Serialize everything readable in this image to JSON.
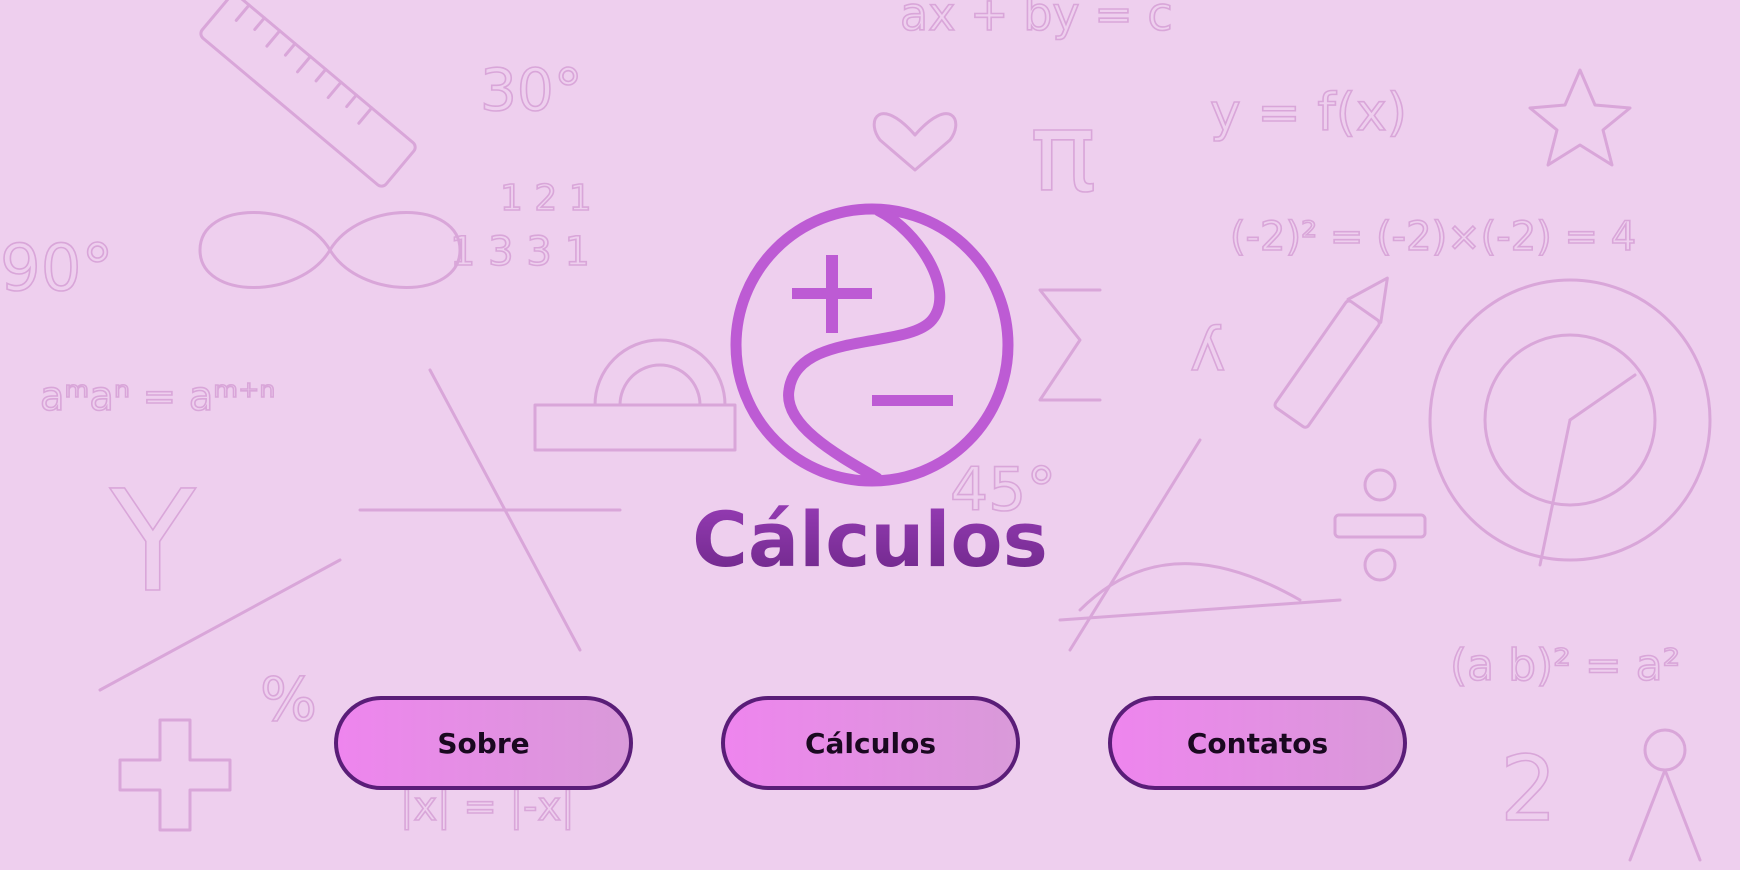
{
  "title": "Cálculos",
  "logo": {
    "icon": "plus-minus-circle-icon",
    "color": "#bd5bd4"
  },
  "nav": {
    "buttons": [
      {
        "label": "Sobre"
      },
      {
        "label": "Cálculos"
      },
      {
        "label": "Contatos"
      }
    ]
  },
  "background": {
    "color": "#eecfee",
    "pattern": "math-doodles"
  },
  "colors": {
    "title": "#7a2d96",
    "button_border": "#5a1d78",
    "button_gradient_start": "#ee85ee",
    "button_gradient_end": "#d99ad9"
  }
}
